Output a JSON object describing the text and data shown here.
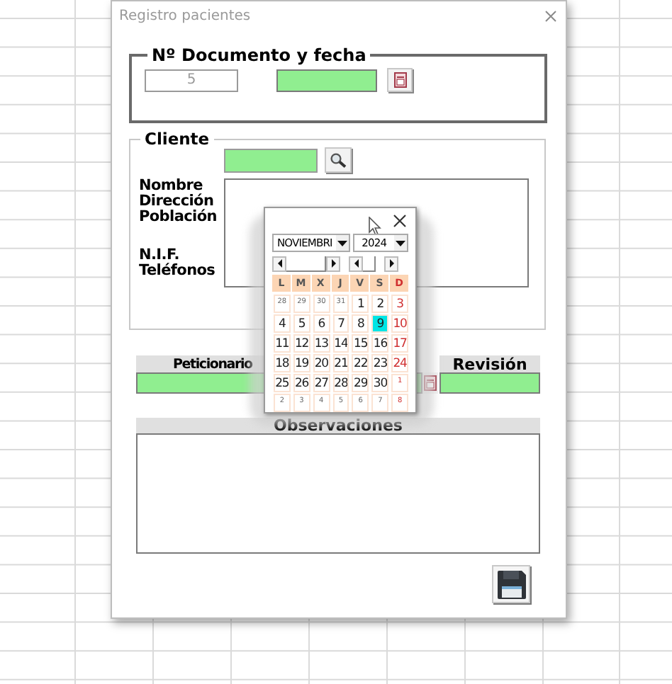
{
  "window": {
    "title": "Registro pacientes"
  },
  "documento": {
    "label": "Nº Documento y fecha",
    "number": "5"
  },
  "cliente": {
    "label": "Cliente",
    "labels_top": [
      "Nombre",
      "Dirección",
      "Población"
    ],
    "labels_bottom": [
      "N.I.F.",
      "Teléfonos"
    ]
  },
  "peticionario": {
    "label": "Peticionario"
  },
  "revision": {
    "label": "Revisión"
  },
  "observaciones": {
    "label": "Observaciones"
  },
  "calendar": {
    "month": "NOVIEMBRI",
    "year": "2024",
    "weekdays": [
      {
        "label": "L",
        "holiday": false
      },
      {
        "label": "M",
        "holiday": false
      },
      {
        "label": "X",
        "holiday": false
      },
      {
        "label": "J",
        "holiday": false
      },
      {
        "label": "V",
        "holiday": false
      },
      {
        "label": "S",
        "holiday": false
      },
      {
        "label": "D",
        "holiday": true
      }
    ],
    "weeks": [
      [
        {
          "day": "28",
          "outside": true,
          "selected": false
        },
        {
          "day": "29",
          "outside": true,
          "selected": false
        },
        {
          "day": "30",
          "outside": true,
          "selected": false
        },
        {
          "day": "31",
          "outside": true,
          "selected": false
        },
        {
          "day": "1",
          "outside": false,
          "selected": false
        },
        {
          "day": "2",
          "outside": false,
          "selected": false
        },
        {
          "day": "3",
          "outside": false,
          "selected": false
        }
      ],
      [
        {
          "day": "4",
          "outside": false,
          "selected": false
        },
        {
          "day": "5",
          "outside": false,
          "selected": false
        },
        {
          "day": "6",
          "outside": false,
          "selected": false
        },
        {
          "day": "7",
          "outside": false,
          "selected": false
        },
        {
          "day": "8",
          "outside": false,
          "selected": false
        },
        {
          "day": "9",
          "outside": false,
          "selected": true
        },
        {
          "day": "10",
          "outside": false,
          "selected": false
        }
      ],
      [
        {
          "day": "11",
          "outside": false,
          "selected": false
        },
        {
          "day": "12",
          "outside": false,
          "selected": false
        },
        {
          "day": "13",
          "outside": false,
          "selected": false
        },
        {
          "day": "14",
          "outside": false,
          "selected": false
        },
        {
          "day": "15",
          "outside": false,
          "selected": false
        },
        {
          "day": "16",
          "outside": false,
          "selected": false
        },
        {
          "day": "17",
          "outside": false,
          "selected": false
        }
      ],
      [
        {
          "day": "18",
          "outside": false,
          "selected": false
        },
        {
          "day": "19",
          "outside": false,
          "selected": false
        },
        {
          "day": "20",
          "outside": false,
          "selected": false
        },
        {
          "day": "21",
          "outside": false,
          "selected": false
        },
        {
          "day": "22",
          "outside": false,
          "selected": false
        },
        {
          "day": "23",
          "outside": false,
          "selected": false
        },
        {
          "day": "24",
          "outside": false,
          "selected": false
        }
      ],
      [
        {
          "day": "25",
          "outside": false,
          "selected": false
        },
        {
          "day": "26",
          "outside": false,
          "selected": false
        },
        {
          "day": "27",
          "outside": false,
          "selected": false
        },
        {
          "day": "28",
          "outside": false,
          "selected": false
        },
        {
          "day": "29",
          "outside": false,
          "selected": false
        },
        {
          "day": "30",
          "outside": false,
          "selected": false
        },
        {
          "day": "1",
          "outside": true,
          "selected": false
        }
      ],
      [
        {
          "day": "2",
          "outside": true,
          "selected": false
        },
        {
          "day": "3",
          "outside": true,
          "selected": false
        },
        {
          "day": "4",
          "outside": true,
          "selected": false
        },
        {
          "day": "5",
          "outside": true,
          "selected": false
        },
        {
          "day": "6",
          "outside": true,
          "selected": false
        },
        {
          "day": "7",
          "outside": true,
          "selected": false
        },
        {
          "day": "8",
          "outside": true,
          "selected": false
        }
      ]
    ]
  }
}
